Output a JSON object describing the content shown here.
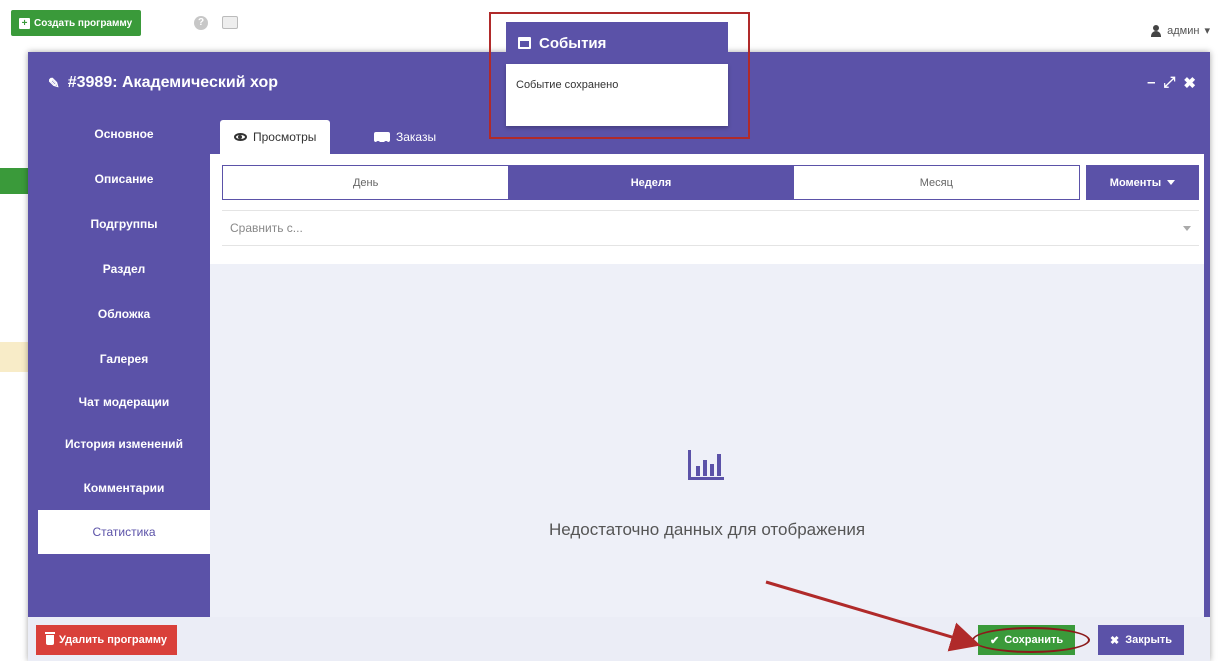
{
  "topbar": {
    "create_label": "Создать программу",
    "user_label": "админ"
  },
  "modal": {
    "title": "#3989: Академический хор",
    "window_controls": [
      "–",
      "⤢",
      "✖"
    ]
  },
  "sidebar": {
    "items": [
      {
        "label": "Основное"
      },
      {
        "label": "Описание"
      },
      {
        "label": "Подгруппы"
      },
      {
        "label": "Раздел"
      },
      {
        "label": "Обложка"
      },
      {
        "label": "Галерея"
      },
      {
        "label": "Чат модерации"
      },
      {
        "label": "История изменений"
      },
      {
        "label": "Комментарии"
      },
      {
        "label": "Статистика",
        "active": true
      }
    ]
  },
  "tabs": [
    {
      "label": "Просмотры",
      "icon": "eye-icon",
      "active": true
    },
    {
      "label": "Заказы",
      "icon": "truck-icon"
    }
  ],
  "period": {
    "options": [
      "День",
      "Неделя",
      "Месяц"
    ],
    "selected": "Неделя",
    "moments_label": "Моменты"
  },
  "compare": {
    "placeholder": "Сравнить с..."
  },
  "empty_state": {
    "icon": "bar-chart-icon",
    "text": "Недостаточно данных для отображения"
  },
  "footer": {
    "delete_label": "Удалить программу",
    "save_label": "Сохранить",
    "close_label": "Закрыть"
  },
  "notification": {
    "title": "События",
    "message": "Событие сохранено"
  },
  "colors": {
    "primary": "#5b52a8",
    "success": "#3a9a3a",
    "danger": "#d9403a",
    "annotation": "#b02a2a"
  }
}
